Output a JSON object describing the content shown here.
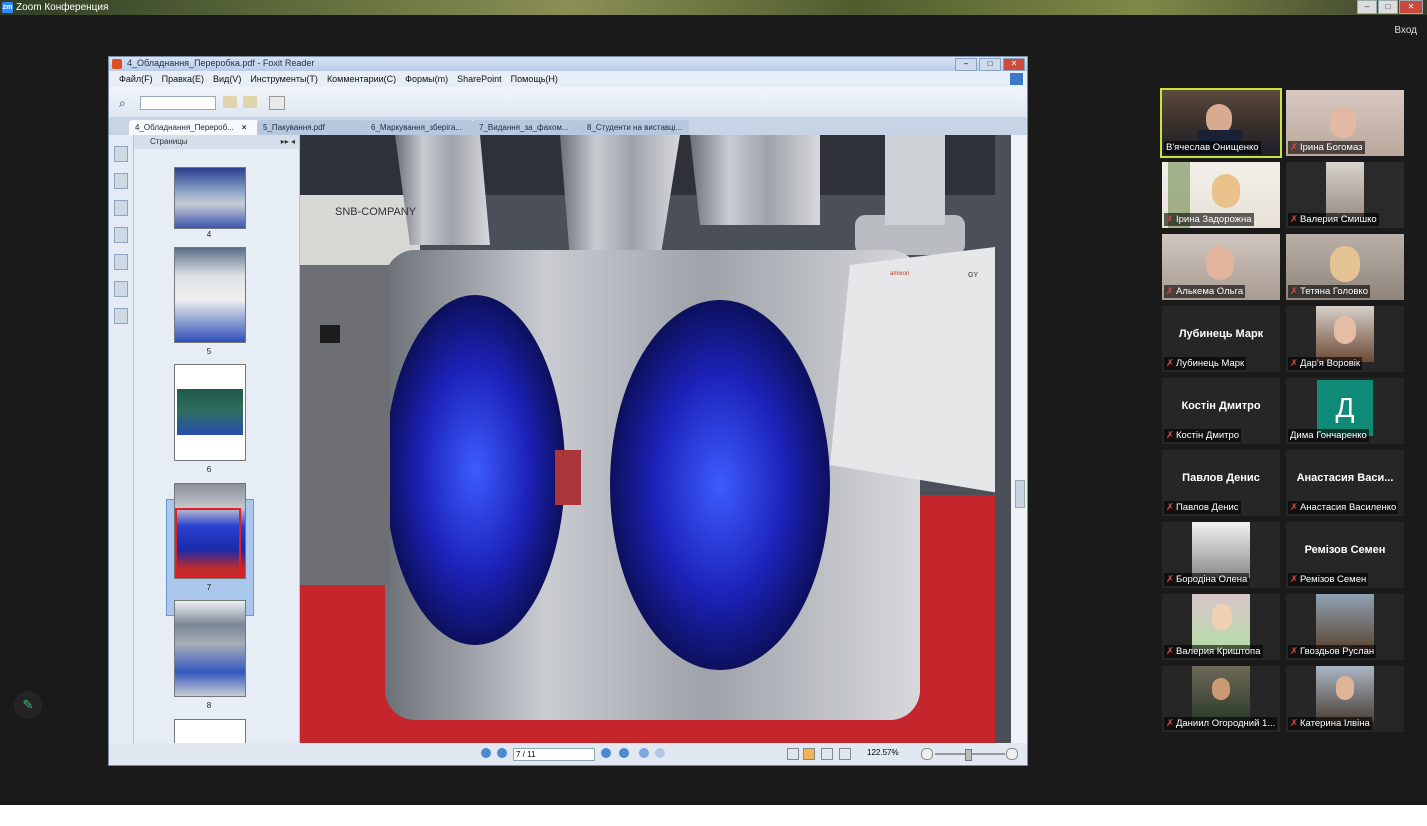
{
  "app": {
    "title": "Zoom Конференция",
    "signin": "Вход"
  },
  "foxit": {
    "title": "4_Обладнання_Переробка.pdf - Foxit Reader",
    "menu": [
      "Файл(F)",
      "Правка(E)",
      "Вид(V)",
      "Инструменты(T)",
      "Комментарии(C)",
      "Формы(m)",
      "SharePoint",
      "Помощь(H)"
    ],
    "tabs": [
      "4_Обладнання_Перероб...",
      "5_Пакування.pdf",
      "6_Маркування_зберіга...",
      "7_Видання_за_фахом...",
      "8_Студенти на виставці..."
    ],
    "panel_title": "Страницы",
    "thumbs": [
      "4",
      "5",
      "6",
      "7",
      "8"
    ],
    "page_field": "7 / 11",
    "zoom": "122.57%",
    "doc_texts": {
      "booth": "SNB-COMPANY",
      "sign_brand": "amixon",
      "sign_brand2": "GY"
    }
  },
  "participants": [
    {
      "name": "В'ячеслав Онищенко",
      "muted": false,
      "active": true
    },
    {
      "name": "Ірина Богомаз",
      "muted": true
    },
    {
      "name": "Ірина Задорожна",
      "muted": true
    },
    {
      "name": "Валерия Смишко",
      "muted": true
    },
    {
      "name": "Алькема Ольга",
      "muted": true
    },
    {
      "name": "Тетяна Головко",
      "muted": true
    },
    {
      "name": "Лубинець Марк",
      "muted": true,
      "big": "Лубинець Марк"
    },
    {
      "name": "Дар'я Воровік",
      "muted": true
    },
    {
      "name": "Костін Дмитро",
      "muted": true,
      "big": "Костін Дмитро"
    },
    {
      "name": "Дима Гончаренко",
      "muted": false,
      "avatar_letter": "Д"
    },
    {
      "name": "Павлов Денис",
      "muted": true,
      "big": "Павлов Денис"
    },
    {
      "name": "Анастасия Василенко",
      "muted": true,
      "big": "Анастасия   Васи..."
    },
    {
      "name": "Бородіна Олена",
      "muted": true
    },
    {
      "name": "Ремізов Семен",
      "muted": true,
      "big": "Ремізов Семен"
    },
    {
      "name": "Валерия Криштопа",
      "muted": true
    },
    {
      "name": "Гвоздьов Руслан",
      "muted": true
    },
    {
      "name": "Даниил Огородний 1...",
      "muted": true
    },
    {
      "name": "Катерина Ілвіна",
      "muted": true
    }
  ],
  "colors": {
    "accent_active": "#c8e33a",
    "muted": "#e0433b",
    "avatar_d": "#0f8a76"
  }
}
